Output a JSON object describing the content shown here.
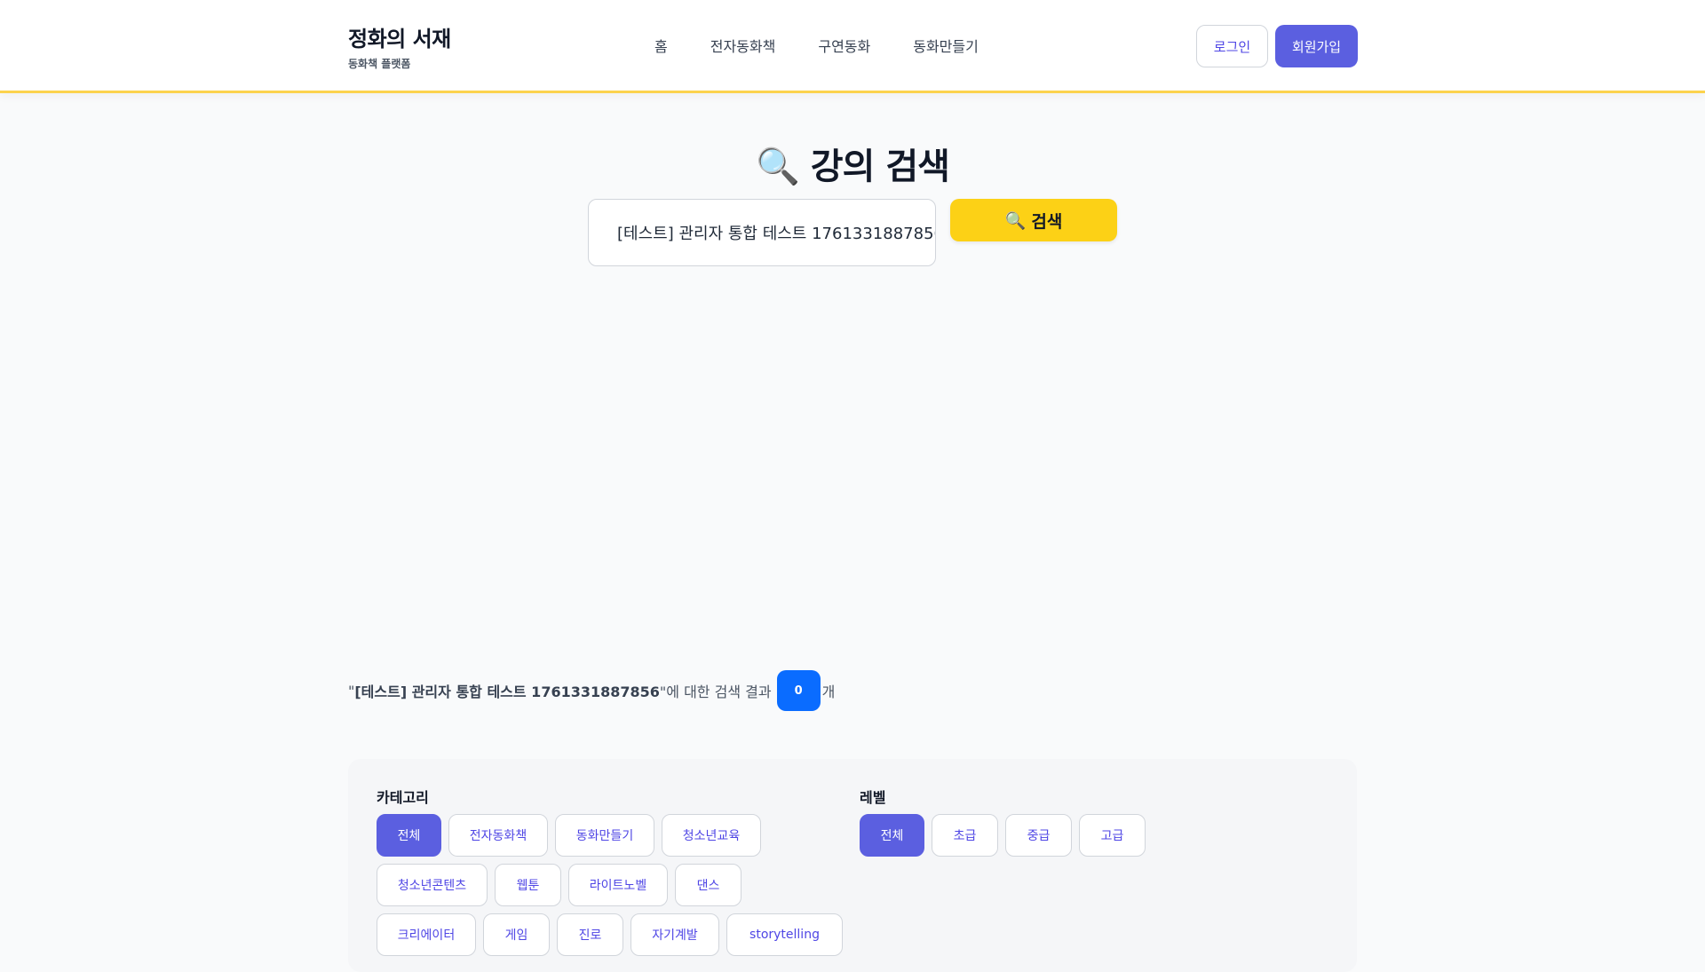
{
  "header": {
    "brand_title": "정화의 서재",
    "brand_subtitle": "동화책 플랫폼",
    "nav": [
      "홈",
      "전자동화책",
      "구연동화",
      "동화만들기"
    ],
    "login_label": "로그인",
    "signup_label": "회원가입"
  },
  "search": {
    "title": "강의 검색",
    "title_icon": "magnifier-icon",
    "query_value": "[테스트] 관리자 통합 테스트 1761331887856",
    "button_label": "검색",
    "button_icon": "magnifier-icon"
  },
  "results": {
    "open_quote": "\"",
    "query": "[테스트] 관리자 통합 테스트 1761331887856",
    "mid_text": "\"에 대한 검색 결과",
    "count": "0",
    "suffix": "개"
  },
  "filters": {
    "category_label": "카테고리",
    "categories": [
      "전체",
      "전자동화책",
      "동화만들기",
      "청소년교육",
      "청소년콘텐츠",
      "웹툰",
      "라이트노벨",
      "댄스",
      "크리에이터",
      "게임",
      "진로",
      "자기계발",
      "storytelling"
    ],
    "level_label": "레벨",
    "levels": [
      "전체",
      "초급",
      "중급",
      "고급"
    ]
  },
  "colors": {
    "primary": "#5b5fe0",
    "search_button": "#fcd116",
    "count_badge": "#0a6cff",
    "header_border": "#fcd34d"
  }
}
